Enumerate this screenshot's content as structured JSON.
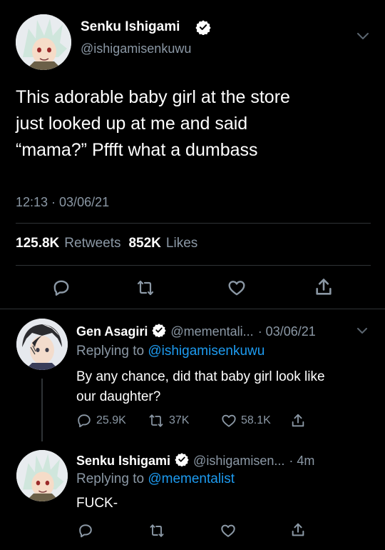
{
  "main_tweet": {
    "display_name": "Senku Ishigami",
    "handle": "@ishigamisenkuwu",
    "text_line1": "This adorable baby girl at the store",
    "text_line2": "just looked up at me and said",
    "text_line3": "“mama?” Pffft what a dumbass",
    "time": "12:13 · 03/06/21",
    "retweets_count": "125.8K",
    "retweets_label": "Retweets",
    "likes_count": "852K",
    "likes_label": "Likes"
  },
  "reply1": {
    "display_name": "Gen Asagiri",
    "handle": "@mementali...",
    "time": "· 03/06/21",
    "replying_label": "Replying to",
    "replying_handle": "@ishigamisenkuwu",
    "text_line1": "By any chance, did that baby girl look like",
    "text_line2": "our daughter?",
    "reply_count": "25.9K",
    "retweet_count": "37K",
    "like_count": "58.1K"
  },
  "reply2": {
    "display_name": "Senku Ishigami",
    "handle": "@ishigamisen...",
    "time": "· 4m",
    "replying_label": "Replying to",
    "replying_handle": "@mementalist",
    "text": "FUCK-"
  },
  "colors": {
    "background": "#000000",
    "accent": "#1d9bf0",
    "muted": "#8b98a5",
    "divider": "#2f3336"
  }
}
